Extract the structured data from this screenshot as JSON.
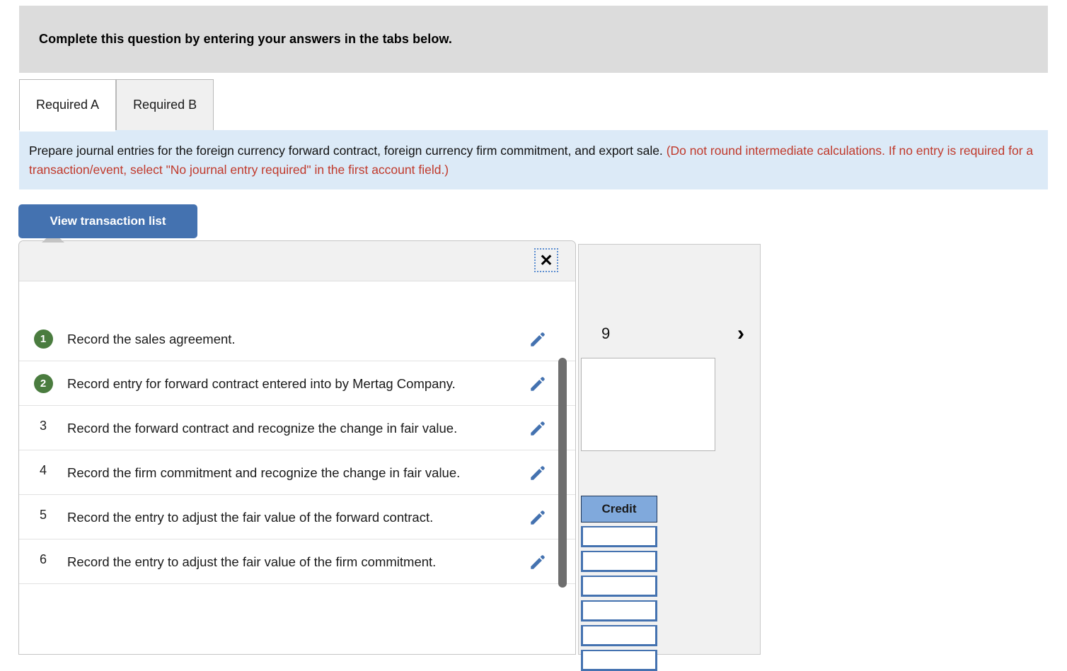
{
  "banner": {
    "text": "Complete this question by entering your answers in the tabs below."
  },
  "tabs": [
    {
      "label": "Required A",
      "active": true
    },
    {
      "label": "Required B",
      "active": false
    }
  ],
  "instruction": {
    "main": "Prepare journal entries for the foreign currency forward contract, foreign currency firm commitment, and export sale.",
    "note": "(Do not round intermediate calculations. If no entry is required for a transaction/event, select \"No journal entry required\" in the first account field.)",
    "note_color": "#c0392b"
  },
  "toolbar": {
    "view_transaction_list_label": "View transaction list",
    "button_color": "#4472b0"
  },
  "popup": {
    "close_label": "✕",
    "rows": [
      {
        "number": "1",
        "completed": true,
        "text": "Record the sales agreement.",
        "edit_icon": "pencil-icon"
      },
      {
        "number": "2",
        "completed": true,
        "text": "Record entry for forward contract entered into by Mertag Company.",
        "edit_icon": "pencil-icon"
      },
      {
        "number": "3",
        "completed": false,
        "text": "Record the forward contract and recognize the change in fair value.",
        "edit_icon": "pencil-icon"
      },
      {
        "number": "4",
        "completed": false,
        "text": "Record the firm commitment and recognize the change in fair value.",
        "edit_icon": "pencil-icon"
      },
      {
        "number": "5",
        "completed": false,
        "text": "Record the entry to adjust the fair value of the forward contract.",
        "edit_icon": "pencil-icon"
      },
      {
        "number": "6",
        "completed": false,
        "text": "Record the entry to adjust the fair value of the firm commitment.",
        "edit_icon": "pencil-icon"
      }
    ],
    "badge_color": "#4a7c3f",
    "pencil_color": "#4472b0"
  },
  "background_form": {
    "page_number": "9",
    "next_label": "›",
    "credit_header": "Credit",
    "credit_rows": [
      "",
      "",
      "",
      "",
      "",
      ""
    ]
  }
}
